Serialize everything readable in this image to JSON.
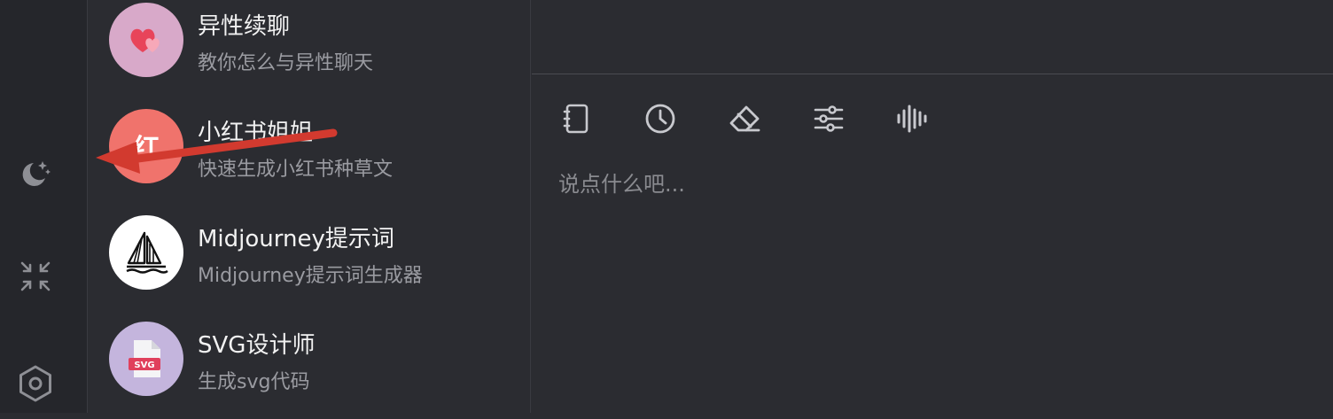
{
  "rail": {
    "items": [
      {
        "icon": "moon-stars-icon"
      },
      {
        "icon": "collapse-arrows-icon"
      },
      {
        "icon": "settings-hexagon-icon"
      }
    ]
  },
  "assistants": [
    {
      "title": "异性续聊",
      "subtitle": "教你怎么与异性聊天",
      "icon": "hearts-icon",
      "color": "#d8a9c9"
    },
    {
      "title": "小红书姐姐",
      "subtitle": "快速生成小红书种草文",
      "icon": "xiaohongshu-icon",
      "color": "#f0736c",
      "icon_text": "红"
    },
    {
      "title": "Midjourney提示词",
      "subtitle": "Midjourney提示词生成器",
      "icon": "sailboat-icon",
      "color": "#ffffff"
    },
    {
      "title": "SVG设计师",
      "subtitle": "生成svg代码",
      "icon": "svg-file-icon",
      "color": "#c4b5dd",
      "icon_text": "SVG"
    }
  ],
  "toolbar": {
    "items": [
      "notebook-icon",
      "history-clock-icon",
      "eraser-icon",
      "sliders-icon",
      "voice-wave-icon"
    ]
  },
  "chat": {
    "placeholder": "说点什么吧..."
  },
  "annotation": {
    "color": "#d23a2f",
    "icon": "red-arrow-annotation"
  }
}
